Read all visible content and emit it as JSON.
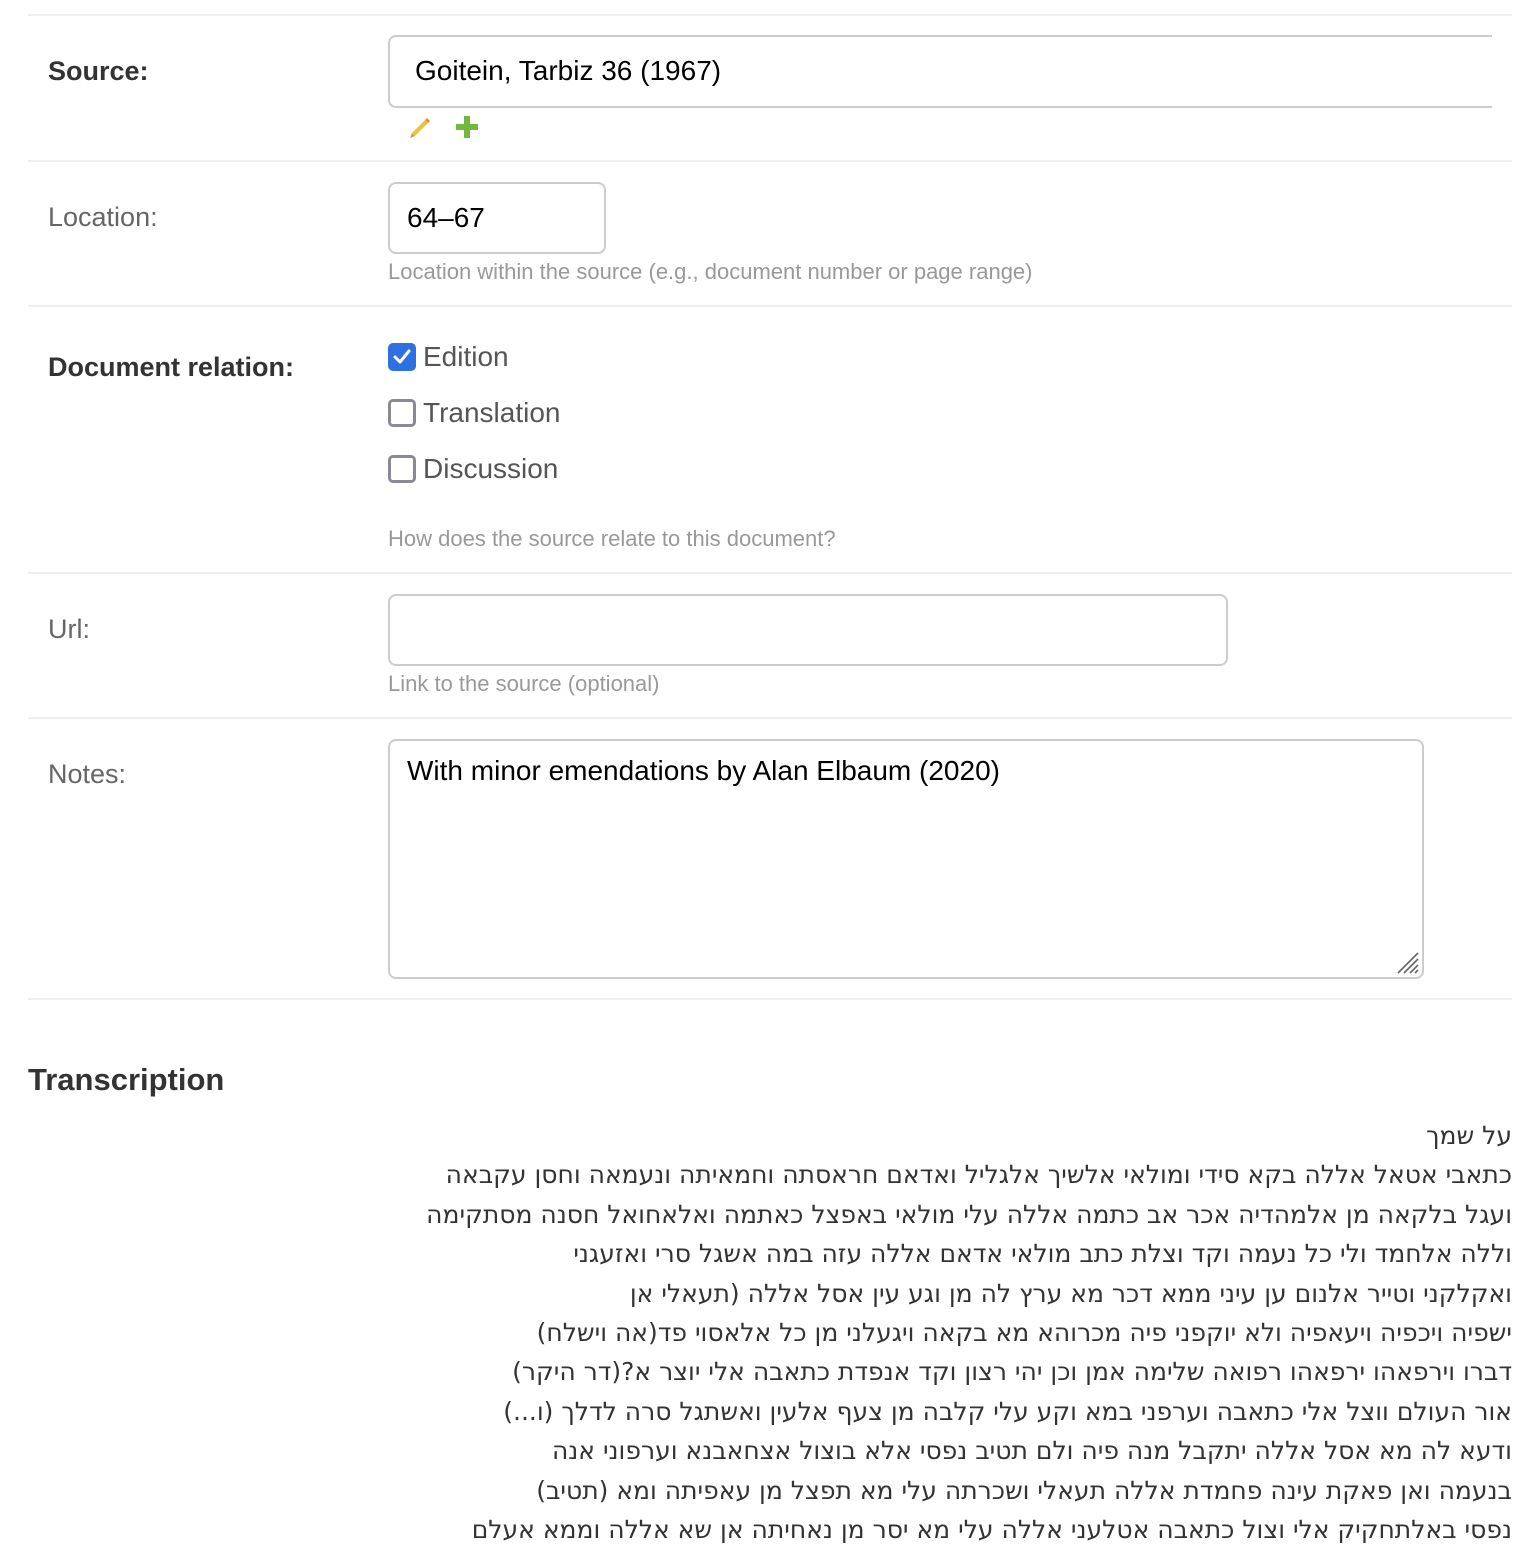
{
  "fields": {
    "source": {
      "label": "Source:",
      "value": "Goitein, Tarbiz 36 (1967)",
      "actions": [
        "pencil-icon",
        "plus-icon"
      ]
    },
    "location": {
      "label": "Location:",
      "value": "64–67",
      "help": "Location within the source (e.g., document number or page range)"
    },
    "document_relation": {
      "label": "Document relation:",
      "options": [
        {
          "label": "Edition",
          "checked": true
        },
        {
          "label": "Translation",
          "checked": false
        },
        {
          "label": "Discussion",
          "checked": false
        }
      ],
      "help": "How does the source relate to this document?"
    },
    "url": {
      "label": "Url:",
      "value": "",
      "help": "Link to the source (optional)"
    },
    "notes": {
      "label": "Notes:",
      "value": "With minor emendations by Alan Elbaum (2020)"
    }
  },
  "transcription": {
    "title": "Transcription",
    "lines": [
      "על שמך",
      "כתאבי אטאל אללה בקא סידי ומולאי אלשיך אלגליל ואדאם חראסתה וחמאיתה ונעמאה וחסן עקבאה",
      "ועגל בלקאה מן אלמהדיה אכר אב כתמה אללה עלי מולאי באפצל כאתמה ואלאחואל חסנה מסתקימה",
      "וללה אלחמד ולי כל נעמה וקד וצלת כתב מולאי אדאם אללה עזה במה אשגל סרי ואזעגני",
      "ואקלקני וטייר אלנום ען עיני ממא דכר מא ערץ לה מן וגע עין אסל אללה (תעאלי אן",
      "ישפיה ויכפיה ויעאפיה ולא יוקפני פיה מכרוהא מא בקאה ויגעלני מן כל אלאסוי פד(אה וישלח)",
      "דברו וירפאהו ירפאהו רפואה שלימה אמן וכן יהי רצון וקד אנפדת כתאבה אלי יוצר א?(דר היקר)",
      "אור העולם ווצל אלי כתאבה וערפני במא וקע עלי קלבה מן צעף אלעין ואשתגל סרה לדלך (ו...)",
      "ודעא לה מא אסל אללה יתקבל מנה פיה ולם תטיב נפסי אלא בוצול אצחאבנא וערפוני אנה",
      "בנעמה ואן פאקת עינה פחמדת אללה תעאלי ושכרתה עלי מא תפצל מן עאפיתה ומא (תטיב)",
      "נפסי באלתחקיק אלי וצול כתאבה אטלעני אללה עלי מא יסר מן נאחיתה אן שא אללה וממא אעלם"
    ]
  }
}
